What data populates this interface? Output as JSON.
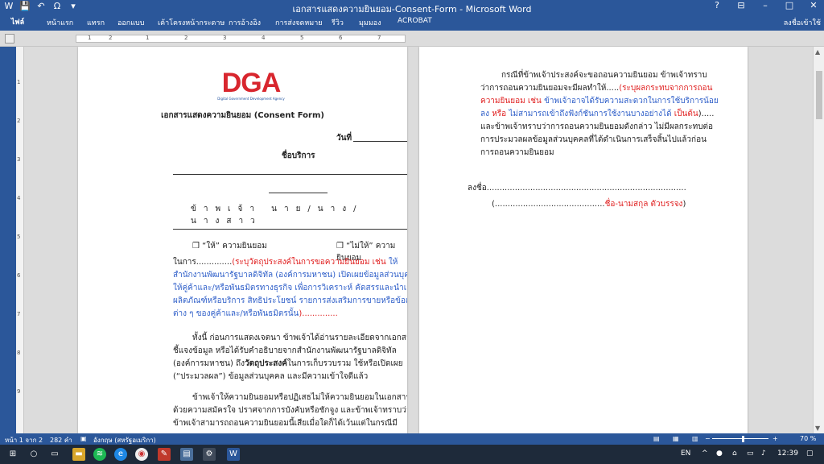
{
  "window": {
    "title": "เอกสารแสดงความยินยอม-Consent-Form - Microsoft Word",
    "controls": [
      "?",
      "⊟",
      "–",
      "□",
      "✕"
    ]
  },
  "qat": [
    "W",
    "💾",
    "↶",
    "Ω",
    "▾"
  ],
  "ribbon": {
    "file": "ไฟล์",
    "tabs": [
      "หน้าแรก",
      "แทรก",
      "ออกแบบ",
      "เค้าโครงหน้ากระดาษ",
      "การอ้างอิง",
      "การส่งจดหมาย",
      "รีวิว",
      "มุมมอง",
      "ACROBAT"
    ],
    "signin": "ลงชื่อเข้าใช้"
  },
  "ruler": {
    "ticks": [
      "1",
      "2",
      "1",
      "2",
      "3",
      "4",
      "5",
      "6",
      "7"
    ]
  },
  "vruler": {
    "ticks": [
      "1",
      "2",
      "3",
      "4",
      "5",
      "6",
      "7",
      "8",
      "9"
    ]
  },
  "page1": {
    "logo_text": "DGA",
    "logo_sub": "Digital Government Development Agency",
    "title": "เอกสารแสดงความยินยอม (Consent Form)",
    "date_label": "วันที่",
    "service_label": "ชื่อบริการ",
    "spaced_line": "ข้าพเจ้า นาย/นาง/นางสาว",
    "consent_yes": "❒ “ให้” ความยินยอม",
    "consent_no": "❒ “ไม่ให้” ความยินยอม",
    "p1_prefix": "ในการ..............",
    "p1_red": "(ระบุวัตถุประสงค์ในการขอความยินยอม เช่น ",
    "p1_blue": "ให้สำนักงานพัฒนารัฐบาลดิจิทัล (องค์การมหาชน) เปิดเผยข้อมูลส่วนบุคคลให้คู่ค้าและ/หรือพันธมิตรทางธุรกิจ เพื่อการวิเคราะห์ คัดสรรและนำเสนอผลิตภัณฑ์หรือบริการ สิทธิประโยชน์ รายการส่งเสริมการขายหรือข้อเสนอต่าง ๆ ของคู่ค้าและ/หรือพันธมิตรนั้น",
    "p1_suffix": ")..............",
    "p2_a": "ทั้งนี้ ก่อนการแสดงเจตนา ข้าพเจ้าได้อ่านรายละเอียดจากเอกสารชี้แจงข้อมูล หรือได้รับคำอธิบายจากสำนักงานพัฒนารัฐบาลดิจิทัล (องค์การมหาชน) ถึง",
    "p2_bold": "วัตถุประสงค์",
    "p2_b": "ในการเก็บรวบรวม ใช้หรือเปิดเผย (“ประมวลผล”) ข้อมูลส่วนบุคคล และมีความเข้าใจดีแล้ว",
    "p3": "ข้าพเจ้าให้ความยินยอมหรือปฏิเสธไม่ให้ความยินยอมในเอกสารนี้ด้วยความสมัครใจ ปราศจากการบังคับหรือชักจูง และข้าพเจ้าทราบว่าข้าพเจ้าสามารถถอนความยินยอมนี้เสียเมื่อใดก็ได้เว้นแต่ในกรณีมี"
  },
  "page2": {
    "p1_a": "กรณีที่ข้าพเจ้าประสงค์จะขอถอนความยินยอม ข้าพเจ้าทราบว่าการถอนความยินยอมจะมีผลทำให้.....",
    "p1_red": "(ระบุผลกระทบจากการถอนความยินยอม เช่น ",
    "p1_blue": "ข้าพเจ้าอาจได้รับความสะดวกในการใช้บริการน้อยลง ",
    "p1_red2": "หรือ ",
    "p1_blue2": "ไม่สามารถเข้าถึงฟังก์ชันการใช้งานบางอย่างได้ ",
    "p1_red3": "เป็นต้น",
    "p1_b": ")..... และข้าพเจ้าทราบว่าการถอนความยินยอมดังกล่าว ไม่มีผลกระทบต่อการประมวลผลข้อมูลส่วนบุคคลที่ได้ดำเนินการเสร็จสิ้นไปแล้วก่อนการถอนความยินยอม",
    "sign_label": "ลงชื่อ..............................................................................",
    "name_dots": "(...........................................",
    "name_red": "ชื่อ-นามสกุล ตัวบรรจง",
    "name_close": ")"
  },
  "status": {
    "page": "หน้า 1 จาก 2",
    "words": "282 คำ",
    "lang": "อังกฤษ (สหรัฐอเมริกา)",
    "zoom": "70 %"
  },
  "taskbar": {
    "lang": "EN",
    "time": "12:39"
  }
}
